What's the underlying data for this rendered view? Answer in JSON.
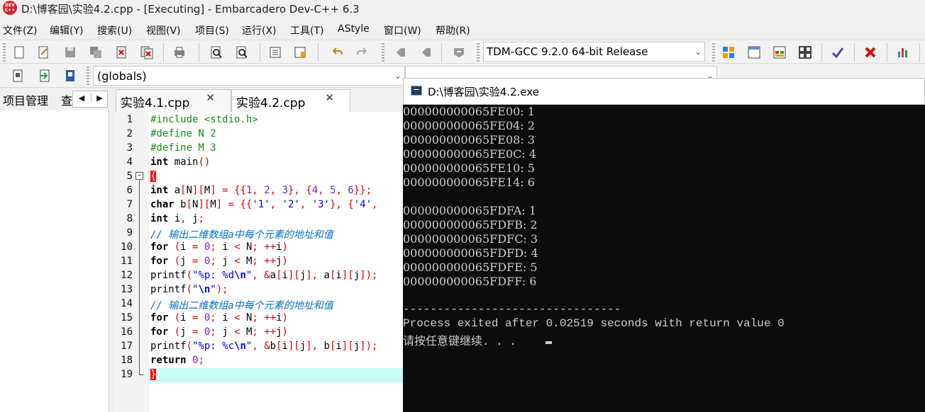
{
  "window": {
    "title": "D:\\博客园\\实验4.2.cpp - [Executing] - Embarcadero Dev-C++ 6.3",
    "icon_text": "DEV C++"
  },
  "menu": [
    "文件(Z)",
    "编辑(Y)",
    "搜索(U)",
    "视图(V)",
    "项目(S)",
    "运行(X)",
    "工具(T)",
    "AStyle",
    "窗口(W)",
    "帮助(R)"
  ],
  "toolbar": {
    "compiler": "TDM-GCC 9.2.0 64-bit Release",
    "globals": "(globals)"
  },
  "left_panel": {
    "tab_project": "项目管理",
    "tab_other": "查"
  },
  "editor_tabs": [
    "实验4.1.cpp",
    "实验4.2.cpp"
  ],
  "line_numbers": [
    "1",
    "2",
    "3",
    "4",
    "5",
    "6",
    "7",
    "8",
    "9",
    "10",
    "11",
    "12",
    "13",
    "14",
    "15",
    "16",
    "17",
    "18",
    "19"
  ],
  "code": [
    [
      [
        "pp",
        "#include <stdio.h>"
      ]
    ],
    [
      [
        "pp",
        "#define N 2"
      ]
    ],
    [
      [
        "pp",
        "#define M 3"
      ]
    ],
    [
      [
        "kw",
        "int"
      ],
      [
        "t",
        " main"
      ],
      [
        "sym",
        "()"
      ]
    ],
    [
      [
        "bh",
        "{"
      ]
    ],
    [
      [
        "kw",
        "int"
      ],
      [
        "t",
        " a"
      ],
      [
        "sym",
        "["
      ],
      [
        "t",
        "N"
      ],
      [
        "sym",
        "]["
      ],
      [
        "t",
        "M"
      ],
      [
        "sym",
        "]"
      ],
      [
        "t",
        " "
      ],
      [
        "sym",
        "="
      ],
      [
        "t",
        " "
      ],
      [
        "sym",
        "{{"
      ],
      [
        "num",
        "1"
      ],
      [
        "sym",
        ","
      ],
      [
        "t",
        " "
      ],
      [
        "num",
        "2"
      ],
      [
        "sym",
        ","
      ],
      [
        "t",
        " "
      ],
      [
        "num",
        "3"
      ],
      [
        "sym",
        "},"
      ],
      [
        "t",
        " "
      ],
      [
        "sym",
        "{"
      ],
      [
        "num",
        "4"
      ],
      [
        "sym",
        ","
      ],
      [
        "t",
        " "
      ],
      [
        "num",
        "5"
      ],
      [
        "sym",
        ","
      ],
      [
        "t",
        " "
      ],
      [
        "num",
        "6"
      ],
      [
        "sym",
        "}};"
      ]
    ],
    [
      [
        "kw",
        "char"
      ],
      [
        "t",
        " b"
      ],
      [
        "sym",
        "["
      ],
      [
        "t",
        "N"
      ],
      [
        "sym",
        "]["
      ],
      [
        "t",
        "M"
      ],
      [
        "sym",
        "]"
      ],
      [
        "t",
        " "
      ],
      [
        "sym",
        "="
      ],
      [
        "t",
        " "
      ],
      [
        "sym",
        "{{"
      ],
      [
        "str",
        "'1'"
      ],
      [
        "sym",
        ","
      ],
      [
        "t",
        " "
      ],
      [
        "str",
        "'2'"
      ],
      [
        "sym",
        ","
      ],
      [
        "t",
        " "
      ],
      [
        "str",
        "'3'"
      ],
      [
        "sym",
        "},"
      ],
      [
        "t",
        " "
      ],
      [
        "sym",
        "{"
      ],
      [
        "str",
        "'4'"
      ],
      [
        "sym",
        ","
      ]
    ],
    [
      [
        "kw",
        "int"
      ],
      [
        "t",
        " i"
      ],
      [
        "sym",
        ","
      ],
      [
        "t",
        " j"
      ],
      [
        "sym",
        ";"
      ]
    ],
    [
      [
        "cm",
        "// 输出二维数组a中每个元素的地址和值"
      ]
    ],
    [
      [
        "kw",
        "for"
      ],
      [
        "t",
        " "
      ],
      [
        "sym",
        "("
      ],
      [
        "t",
        "i "
      ],
      [
        "sym",
        "="
      ],
      [
        "t",
        " "
      ],
      [
        "num",
        "0"
      ],
      [
        "sym",
        ";"
      ],
      [
        "t",
        " i "
      ],
      [
        "sym",
        "<"
      ],
      [
        "t",
        " N"
      ],
      [
        "sym",
        ";"
      ],
      [
        "t",
        " "
      ],
      [
        "sym",
        "++"
      ],
      [
        "t",
        "i"
      ],
      [
        "sym",
        ")"
      ]
    ],
    [
      [
        "kw",
        "for"
      ],
      [
        "t",
        " "
      ],
      [
        "sym",
        "("
      ],
      [
        "t",
        "j "
      ],
      [
        "sym",
        "="
      ],
      [
        "t",
        " "
      ],
      [
        "num",
        "0"
      ],
      [
        "sym",
        ";"
      ],
      [
        "t",
        " j "
      ],
      [
        "sym",
        "<"
      ],
      [
        "t",
        " M"
      ],
      [
        "sym",
        ";"
      ],
      [
        "t",
        " "
      ],
      [
        "sym",
        "++"
      ],
      [
        "t",
        "j"
      ],
      [
        "sym",
        ")"
      ]
    ],
    [
      [
        "t",
        "printf"
      ],
      [
        "sym",
        "("
      ],
      [
        "str",
        "\"%p: %d"
      ],
      [
        "esc",
        "\\n"
      ],
      [
        "str",
        "\""
      ],
      [
        "sym",
        ","
      ],
      [
        "t",
        " "
      ],
      [
        "sym",
        "&"
      ],
      [
        "t",
        "a"
      ],
      [
        "sym",
        "["
      ],
      [
        "t",
        "i"
      ],
      [
        "sym",
        "]["
      ],
      [
        "t",
        "j"
      ],
      [
        "sym",
        "],"
      ],
      [
        "t",
        " a"
      ],
      [
        "sym",
        "["
      ],
      [
        "t",
        "i"
      ],
      [
        "sym",
        "]["
      ],
      [
        "t",
        "j"
      ],
      [
        "sym",
        "]);"
      ]
    ],
    [
      [
        "t",
        "printf"
      ],
      [
        "sym",
        "("
      ],
      [
        "str",
        "\""
      ],
      [
        "esc",
        "\\n"
      ],
      [
        "str",
        "\""
      ],
      [
        "sym",
        ");"
      ]
    ],
    [
      [
        "cm",
        "// 输出二维数组a中每个元素的地址和值"
      ]
    ],
    [
      [
        "kw",
        "for"
      ],
      [
        "t",
        " "
      ],
      [
        "sym",
        "("
      ],
      [
        "t",
        "i "
      ],
      [
        "sym",
        "="
      ],
      [
        "t",
        " "
      ],
      [
        "num",
        "0"
      ],
      [
        "sym",
        ";"
      ],
      [
        "t",
        " i "
      ],
      [
        "sym",
        "<"
      ],
      [
        "t",
        " N"
      ],
      [
        "sym",
        ";"
      ],
      [
        "t",
        " "
      ],
      [
        "sym",
        "++"
      ],
      [
        "t",
        "i"
      ],
      [
        "sym",
        ")"
      ]
    ],
    [
      [
        "kw",
        "for"
      ],
      [
        "t",
        " "
      ],
      [
        "sym",
        "("
      ],
      [
        "t",
        "j "
      ],
      [
        "sym",
        "="
      ],
      [
        "t",
        " "
      ],
      [
        "num",
        "0"
      ],
      [
        "sym",
        ";"
      ],
      [
        "t",
        " j "
      ],
      [
        "sym",
        "<"
      ],
      [
        "t",
        " M"
      ],
      [
        "sym",
        ";"
      ],
      [
        "t",
        " "
      ],
      [
        "sym",
        "++"
      ],
      [
        "t",
        "j"
      ],
      [
        "sym",
        ")"
      ]
    ],
    [
      [
        "t",
        "printf"
      ],
      [
        "sym",
        "("
      ],
      [
        "str",
        "\"%p: %c"
      ],
      [
        "esc",
        "\\n"
      ],
      [
        "str",
        "\""
      ],
      [
        "sym",
        ","
      ],
      [
        "t",
        " "
      ],
      [
        "sym",
        "&"
      ],
      [
        "t",
        "b"
      ],
      [
        "sym",
        "["
      ],
      [
        "t",
        "i"
      ],
      [
        "sym",
        "]["
      ],
      [
        "t",
        "j"
      ],
      [
        "sym",
        "],"
      ],
      [
        "t",
        " b"
      ],
      [
        "sym",
        "["
      ],
      [
        "t",
        "i"
      ],
      [
        "sym",
        "]["
      ],
      [
        "t",
        "j"
      ],
      [
        "sym",
        "]);"
      ]
    ],
    [
      [
        "kw",
        "return"
      ],
      [
        "t",
        " "
      ],
      [
        "num",
        "0"
      ],
      [
        "sym",
        ";"
      ]
    ],
    [
      [
        "bh",
        "}"
      ]
    ]
  ],
  "console": {
    "title": "D:\\博客园\\实验4.2.exe",
    "lines": [
      "000000000065FE00: 1",
      "000000000065FE04: 2",
      "000000000065FE08: 3",
      "000000000065FE0C: 4",
      "000000000065FE10: 5",
      "000000000065FE14: 6",
      "",
      "000000000065FDFA: 1",
      "000000000065FDFB: 2",
      "000000000065FDFC: 3",
      "000000000065FDFD: 4",
      "000000000065FDFE: 5",
      "000000000065FDFF: 6",
      "",
      "--------------------------------",
      "Process exited after 0.02519 seconds with return value 0",
      "请按任意键继续. . ."
    ]
  },
  "colors": {
    "keyword": "#000000",
    "preprocessor": "#1a8c1a",
    "symbol": "#e00000",
    "number": "#7a1fc8",
    "string": "#0000ff",
    "comment": "#0070c0",
    "current_line": "#c8fafa",
    "console_bg": "#0c0c0c",
    "console_fg": "#cccccc"
  }
}
